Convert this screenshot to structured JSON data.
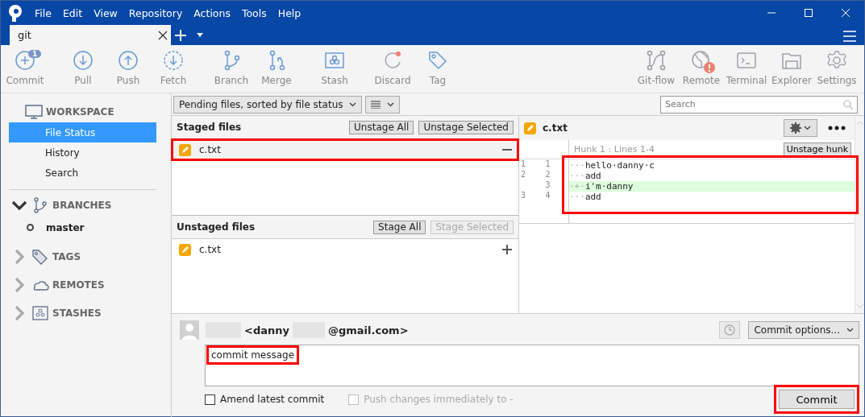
{
  "menu": [
    "File",
    "Edit",
    "View",
    "Repository",
    "Actions",
    "Tools",
    "Help"
  ],
  "tabs": [
    {
      "label": "git",
      "selected": true
    }
  ],
  "toolbar_left": [
    {
      "label": "Commit",
      "kind": "commit",
      "badge": "1"
    },
    {
      "label": "Pull",
      "kind": "pull"
    },
    {
      "label": "Push",
      "kind": "push"
    },
    {
      "label": "Fetch",
      "kind": "fetch"
    },
    {
      "label": "Branch",
      "kind": "branch"
    },
    {
      "label": "Merge",
      "kind": "merge"
    },
    {
      "label": "Stash",
      "kind": "stash"
    },
    {
      "label": "Discard",
      "kind": "discard"
    },
    {
      "label": "Tag",
      "kind": "tag"
    }
  ],
  "toolbar_right": [
    {
      "label": "Git-flow",
      "kind": "gitflow"
    },
    {
      "label": "Remote",
      "kind": "remote",
      "alert": true
    },
    {
      "label": "Terminal",
      "kind": "terminal"
    },
    {
      "label": "Explorer",
      "kind": "explorer"
    },
    {
      "label": "Settings",
      "kind": "settings"
    }
  ],
  "sidebar": [
    {
      "title": "WORKSPACE",
      "kind": "workspace",
      "items": [
        {
          "label": "File Status",
          "selected": true
        },
        {
          "label": "History",
          "selected": false
        },
        {
          "label": "Search",
          "selected": false
        }
      ]
    },
    {
      "title": "BRANCHES",
      "kind": "branches",
      "expanded": true,
      "items": [
        {
          "label": "master",
          "current": true
        }
      ]
    },
    {
      "title": "TAGS",
      "kind": "tags",
      "expanded": false
    },
    {
      "title": "REMOTES",
      "kind": "remotes",
      "expanded": false
    },
    {
      "title": "STASHES",
      "kind": "stashes",
      "expanded": false
    }
  ],
  "filter": {
    "sort": "Pending files, sorted by file status"
  },
  "search": {
    "placeholder": "Search"
  },
  "staged": {
    "title": "Staged files",
    "buttons": [
      {
        "label": "Unstage All",
        "disabled": false
      },
      {
        "label": "Unstage Selected",
        "disabled": false
      }
    ],
    "files": [
      {
        "name": "c.txt",
        "highlighted": true
      }
    ]
  },
  "unstaged": {
    "title": "Unstaged files",
    "buttons": [
      {
        "label": "Stage All",
        "disabled": false
      },
      {
        "label": "Stage Selected",
        "disabled": true
      }
    ],
    "files": [
      {
        "name": "c.txt",
        "highlighted": false
      }
    ]
  },
  "diff": {
    "file": "c.txt",
    "hunk_title": "Hunk 1 : Lines 1-4",
    "hunk_button": "Unstage hunk",
    "highlighted": true,
    "lines": [
      {
        "old": "1",
        "new": "1",
        "prefix": "···",
        "text": "hello·danny·c",
        "kind": "context"
      },
      {
        "old": "2",
        "new": "2",
        "prefix": "···",
        "text": "add",
        "kind": "context"
      },
      {
        "new": "3",
        "prefix": "·+·",
        "text": "i'm·danny",
        "kind": "added"
      },
      {
        "old": "3",
        "new": "4",
        "prefix": "···",
        "text": "add",
        "kind": "context"
      }
    ]
  },
  "commit": {
    "email_start": "<danny",
    "email_end": "@gmail.com>",
    "options": "Commit options...",
    "message": "commit message",
    "message_highlighted": true,
    "amend": {
      "label": "Amend latest commit",
      "checked": false,
      "disabled": false
    },
    "push": {
      "label": "Push changes immediately to -",
      "checked": false,
      "disabled": true
    },
    "button": {
      "label": "Commit",
      "highlighted": true
    }
  }
}
